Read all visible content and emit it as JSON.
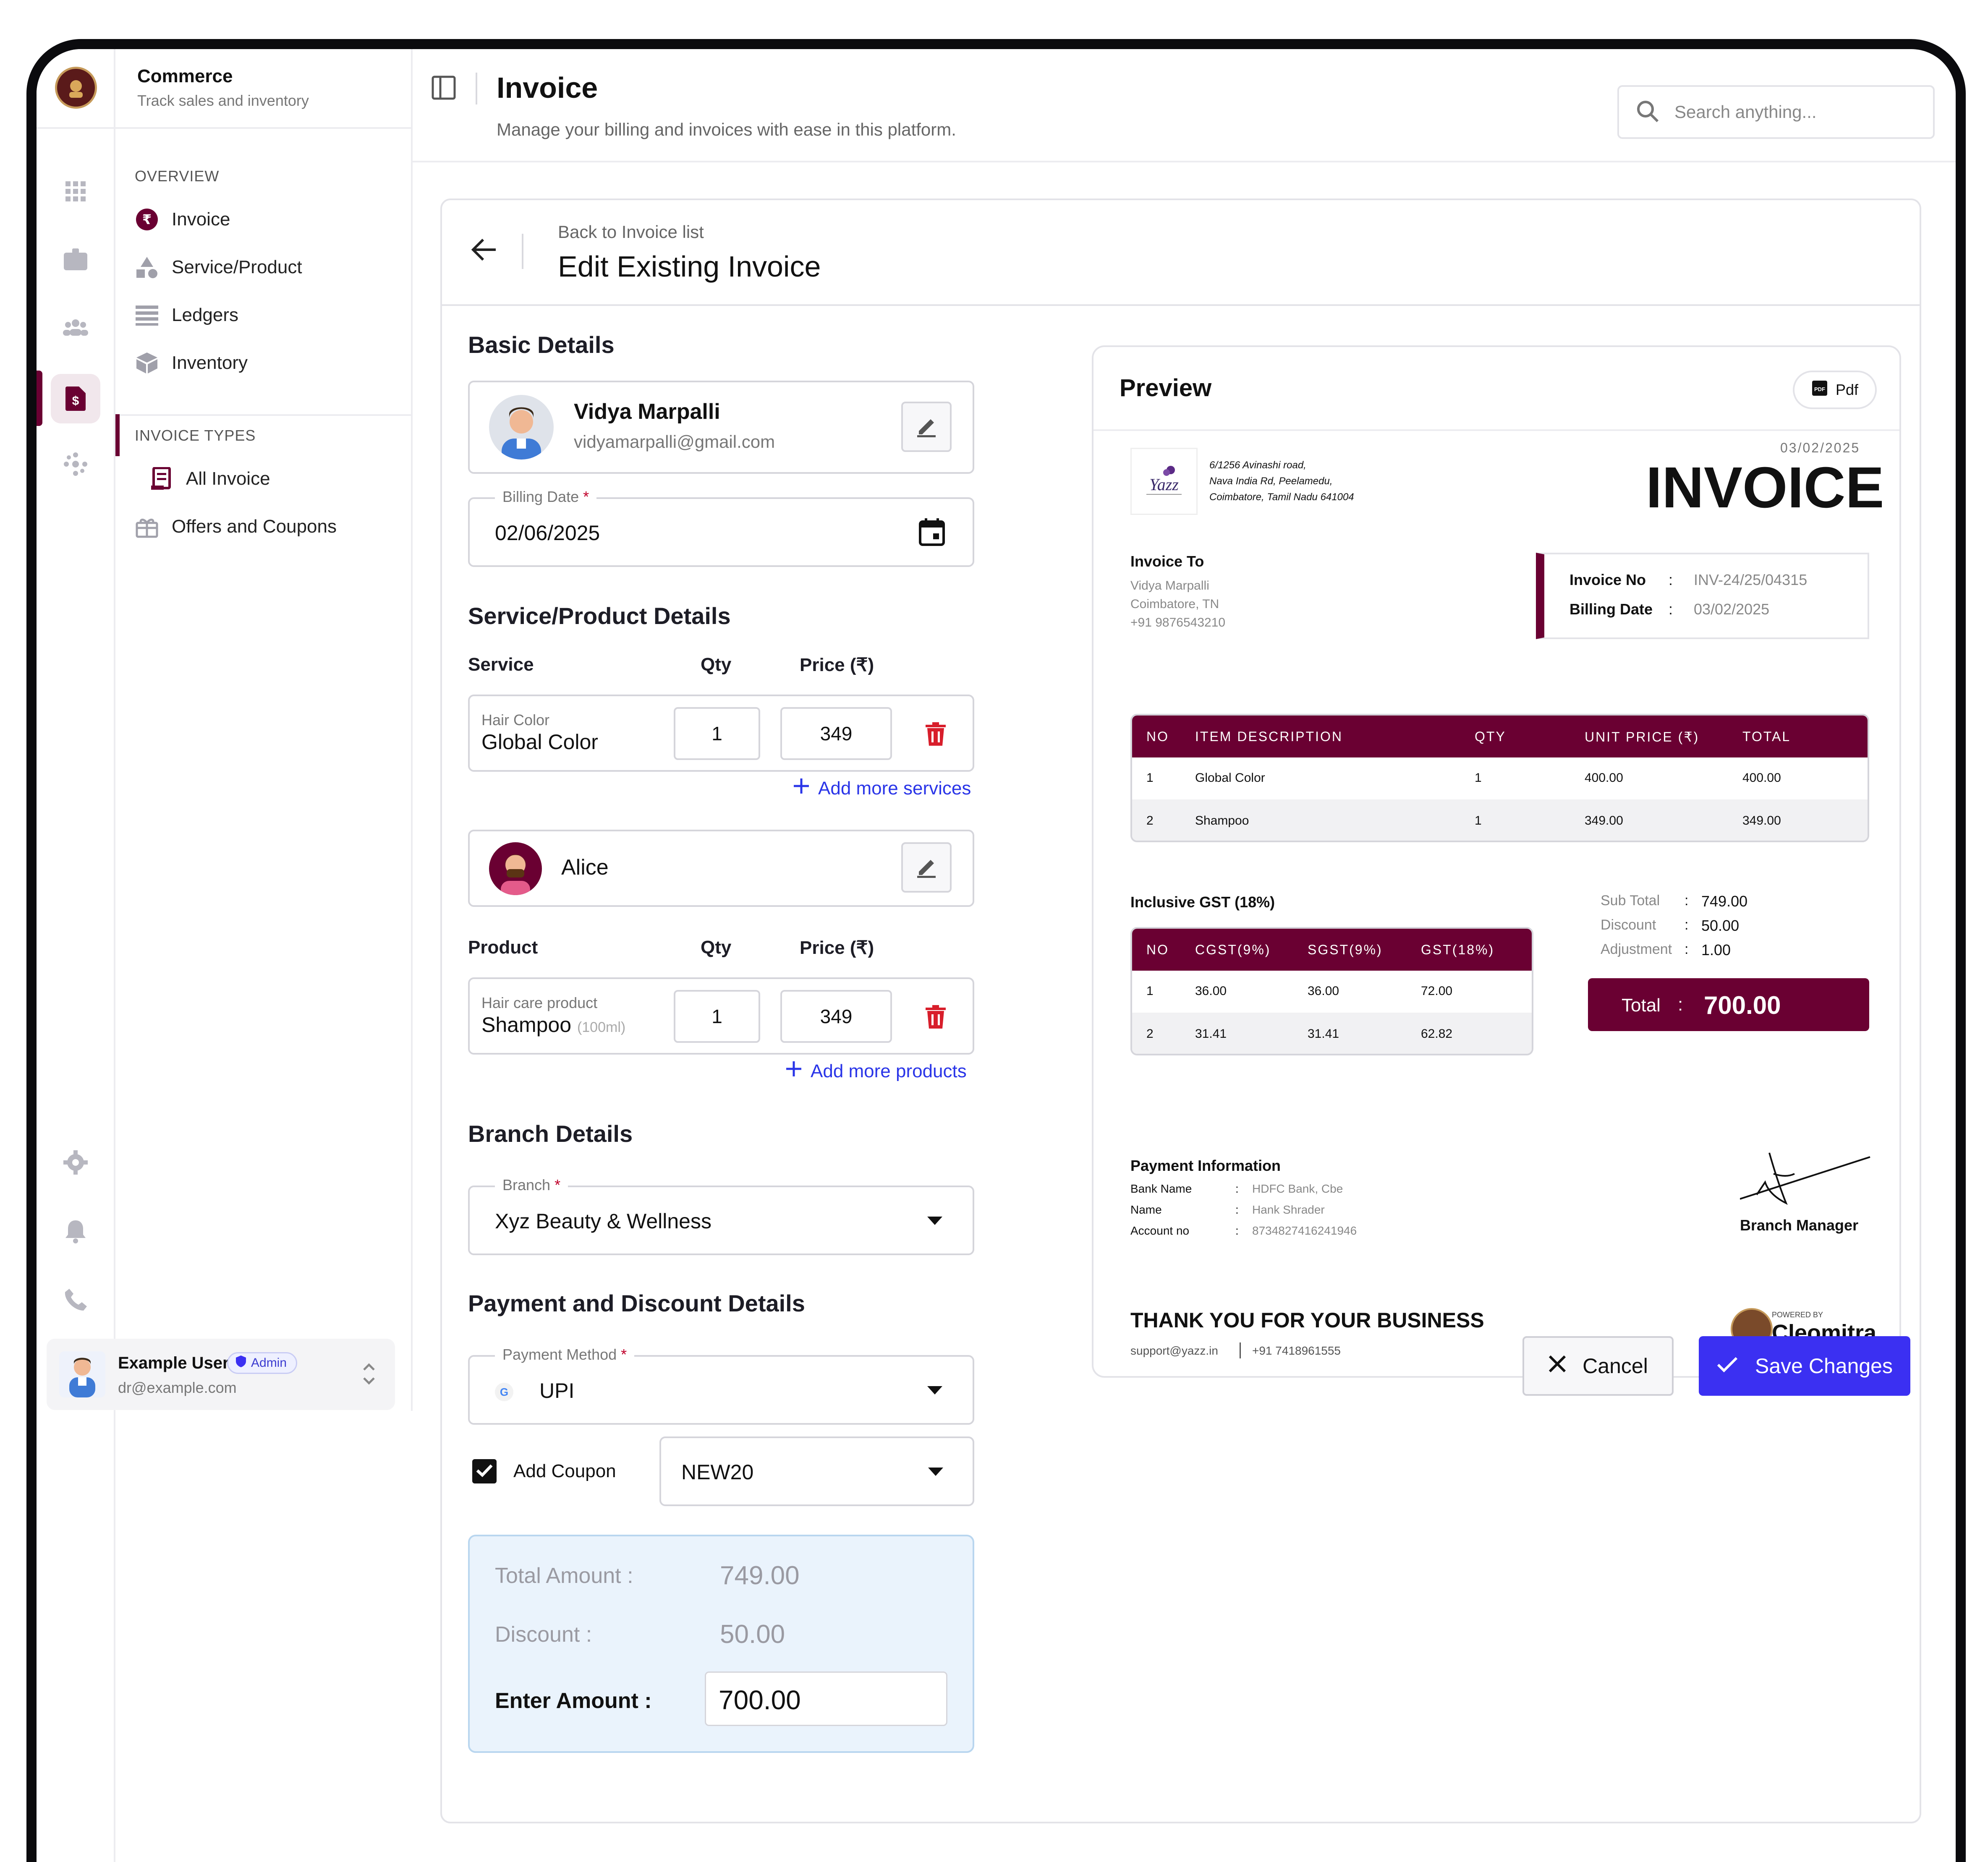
{
  "app": {
    "title": "Commerce",
    "subtitle": "Track sales and inventory"
  },
  "header": {
    "title": "Invoice",
    "subtitle": "Manage your billing and invoices with ease in this platform.",
    "search_placeholder": "Search anything..."
  },
  "sidebar": {
    "overview_label": "OVERVIEW",
    "items": [
      {
        "label": "Invoice",
        "icon": "rupee-icon"
      },
      {
        "label": "Service/Product",
        "icon": "shapes-icon"
      },
      {
        "label": "Ledgers",
        "icon": "list-icon"
      },
      {
        "label": "Inventory",
        "icon": "box-icon"
      }
    ],
    "types_label": "INVOICE TYPES",
    "types": [
      {
        "label": "All Invoice",
        "icon": "receipt-icon"
      },
      {
        "label": "Offers and Coupons",
        "icon": "gift-icon"
      }
    ]
  },
  "user": {
    "name": "Example User",
    "role": "Admin",
    "email": "dr@example.com"
  },
  "page": {
    "back_label": "Back to Invoice list",
    "title": "Edit Existing Invoice"
  },
  "form": {
    "basic_details": "Basic Details",
    "customer": {
      "name": "Vidya Marpalli",
      "email": "vidyamarpalli@gmail.com"
    },
    "billing_date_label": "Billing Date",
    "billing_date": "02/06/2025",
    "service_section": "Service/Product Details",
    "service_cols": {
      "service": "Service",
      "qty": "Qty",
      "price": "Price (₹)"
    },
    "service": {
      "category": "Hair Color",
      "name": "Global Color",
      "qty": "1",
      "price": "349"
    },
    "add_services": "Add more services",
    "staff": {
      "name": "Alice"
    },
    "product_cols": {
      "product": "Product",
      "qty": "Qty",
      "price": "Price (₹)"
    },
    "product": {
      "category": "Hair care product",
      "name": "Shampoo",
      "size": "(100ml)",
      "qty": "1",
      "price": "349"
    },
    "add_products": "Add more products",
    "branch_section": "Branch Details",
    "branch_label": "Branch",
    "branch_value": "Xyz Beauty & Wellness",
    "payment_section": "Payment and Discount Details",
    "payment_label": "Payment Method",
    "payment_value": "UPI",
    "coupon_label": "Add Coupon",
    "coupon_value": "NEW20",
    "coupon_checked": true,
    "total_label": "Total Amount :",
    "total_value": "749.00",
    "discount_label": "Discount :",
    "discount_value": "50.00",
    "enter_label": "Enter Amount :",
    "enter_value": "700.00"
  },
  "preview": {
    "title": "Preview",
    "pdf_label": "Pdf",
    "address": [
      "6/1256 Avinashi road,",
      "Nava India Rd, Peelamedu,",
      "Coimbatore, Tamil Nadu 641004"
    ],
    "date": "03/02/2025",
    "heading": "INVOICE",
    "invoice_to_label": "Invoice To",
    "invoice_to": [
      "Vidya Marpalli",
      "Coimbatore, TN",
      "+91 9876543210"
    ],
    "invoice_no_label": "Invoice No",
    "invoice_no": "INV-24/25/04315",
    "billing_date_label": "Billing Date",
    "billing_date": "03/02/2025",
    "colon": ":",
    "items_head": [
      "NO",
      "ITEM DESCRIPTION",
      "QTY",
      "UNIT PRICE (₹)",
      "TOTAL"
    ],
    "items": [
      [
        "1",
        "Global Color",
        "1",
        "400.00",
        "400.00"
      ],
      [
        "2",
        "Shampoo",
        "1",
        "349.00",
        "349.00"
      ]
    ],
    "gst_title": "Inclusive GST (18%)",
    "gst_head": [
      "NO",
      "CGST(9%)",
      "SGST(9%)",
      "GST(18%)"
    ],
    "gst_rows": [
      [
        "1",
        "36.00",
        "36.00",
        "72.00"
      ],
      [
        "2",
        "31.41",
        "31.41",
        "62.82"
      ]
    ],
    "sub_total_label": "Sub Total",
    "sub_total": "749.00",
    "discount_label": "Discount",
    "discount": "50.00",
    "adjustment_label": "Adjustment",
    "adjustment": "1.00",
    "total_label": "Total",
    "total": "700.00",
    "payment_info_title": "Payment Information",
    "payment_info": [
      [
        "Bank Name",
        "HDFC Bank, Cbe"
      ],
      [
        "Name",
        "Hank Shrader"
      ],
      [
        "Account no",
        "8734827416241946"
      ]
    ],
    "signatory": "Branch Manager",
    "thanks": "THANK YOU FOR YOUR BUSINESS",
    "support_email": "support@yazz.in",
    "support_phone": "+91 7418961555",
    "powered_by": "POWERED BY",
    "powered_brand": "Cleomitra"
  },
  "actions": {
    "cancel": "Cancel",
    "save": "Save Changes"
  },
  "colors": {
    "brand": "#6a0032",
    "primary": "#3b30f2",
    "danger": "#d81e2b",
    "summary_bg": "#eaf3fc"
  }
}
